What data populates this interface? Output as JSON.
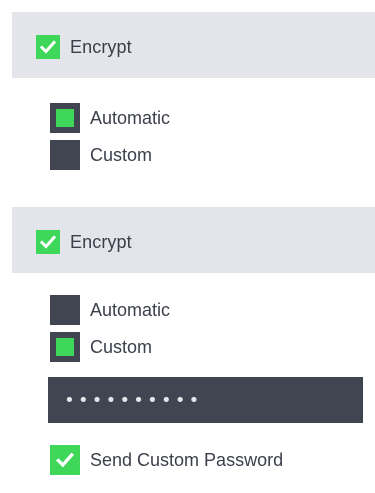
{
  "panel_a": {
    "encrypt": {
      "label": "Encrypt",
      "checked": true
    },
    "mode_options": [
      {
        "label": "Automatic",
        "selected": true
      },
      {
        "label": "Custom",
        "selected": false
      }
    ]
  },
  "panel_b": {
    "encrypt": {
      "label": "Encrypt",
      "checked": true
    },
    "mode_options": [
      {
        "label": "Automatic",
        "selected": false
      },
      {
        "label": "Custom",
        "selected": true
      }
    ],
    "password": {
      "value": "••••••••••"
    },
    "send_custom_password": {
      "label": "Send Custom Password",
      "checked": true
    }
  },
  "colors": {
    "accent": "#3fd75a",
    "dark": "#414551",
    "header_bg": "#e4e5ea",
    "text": "#3b3f4a",
    "page_bg": "#ffffff"
  },
  "icons": {
    "check": "check-icon"
  }
}
